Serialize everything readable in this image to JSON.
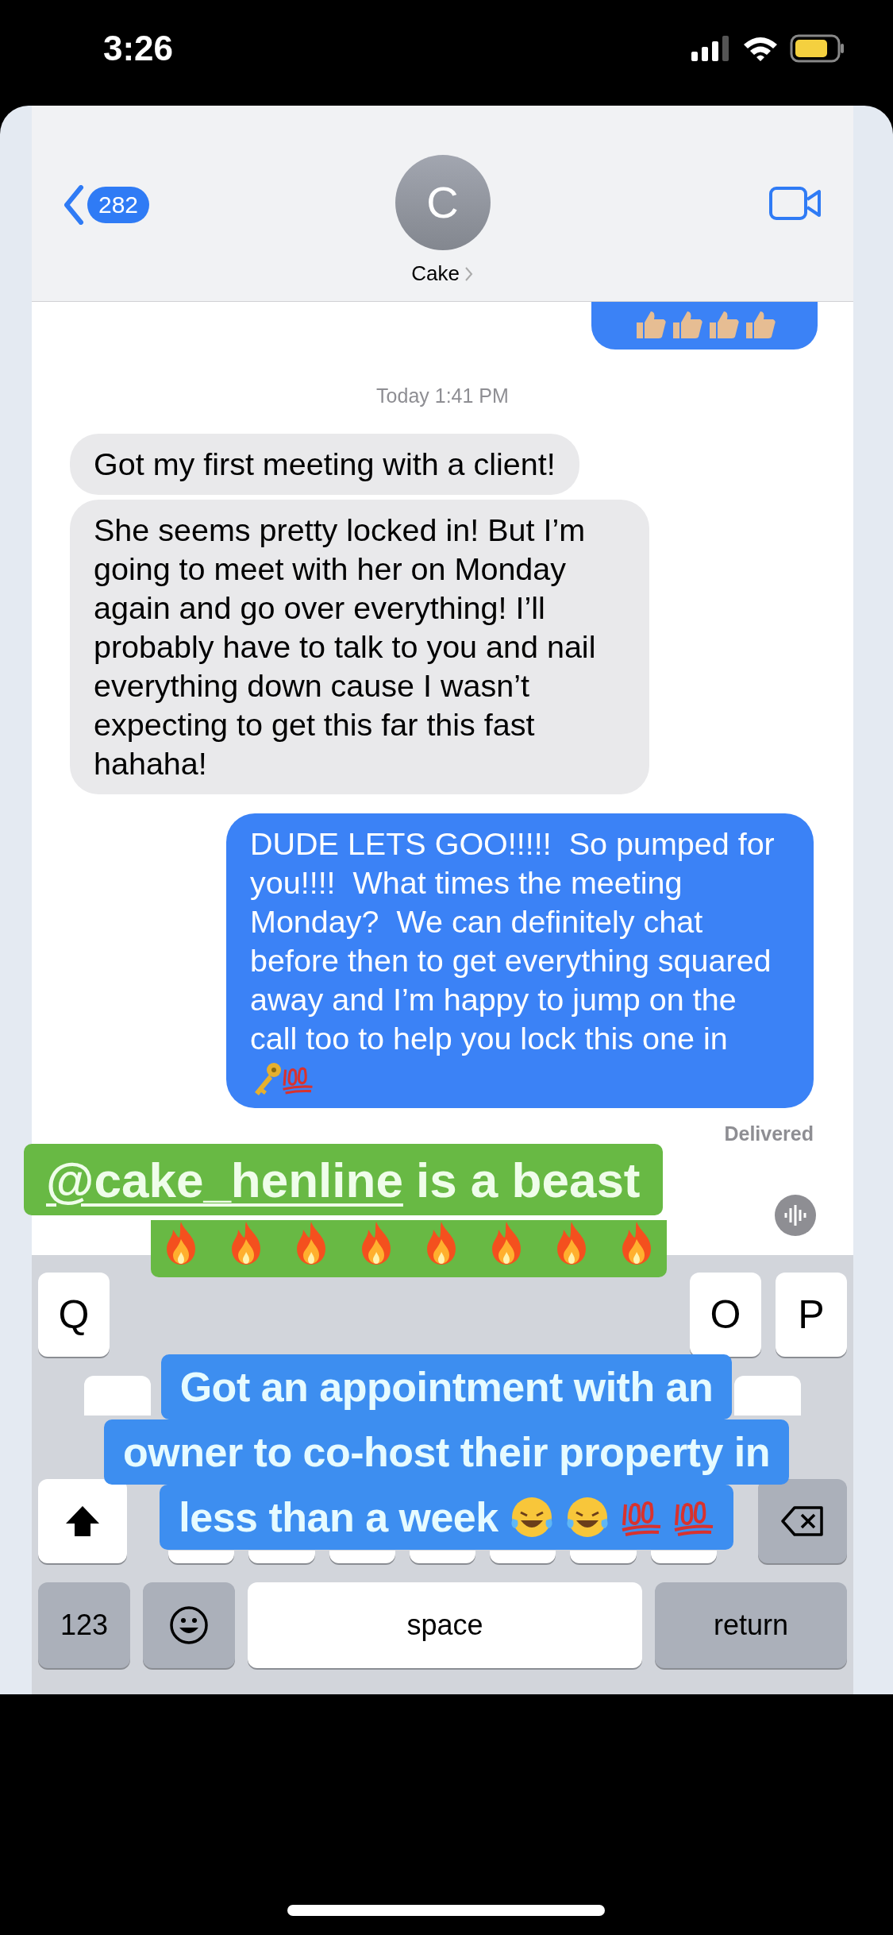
{
  "status_bar": {
    "time": "3:26"
  },
  "header": {
    "back_count": "282",
    "avatar_initial": "C",
    "contact": "Cake"
  },
  "thread": [
    {
      "kind": "emoji"
    },
    {
      "kind": "timestamp",
      "text": "Today 1:41 PM"
    },
    {
      "kind": "incoming",
      "text": "Got my first meeting with a client!"
    },
    {
      "kind": "incoming",
      "text": "She seems pretty locked in! But I’m going to meet with her on Monday again and go over everything! I’ll probably have to talk to you and nail everything down cause I wasn’t expecting to get this far this fast hahaha!"
    },
    {
      "kind": "outgoing",
      "text": "DUDE LETS GOO!!!!!  So pumped for you!!!!  What times the meeting Monday?  We can definitely chat before then to get everything squared away and I’m happy to jump on the call too to help you lock this one in",
      "emoji_tail": true
    },
    {
      "kind": "status",
      "text": "Delivered"
    }
  ],
  "keyboard": {
    "top_row": [
      "Q",
      "O",
      "P"
    ],
    "numbers": "123",
    "space": "space",
    "return": "return"
  },
  "stickers": [
    {
      "kind": "banner",
      "mention": "@cake_henline",
      "text": "is a beast"
    },
    {
      "kind": "caption",
      "lines": [
        "Got an appointment with an",
        "owner to co-host their property in",
        "less than a week"
      ]
    }
  ]
}
